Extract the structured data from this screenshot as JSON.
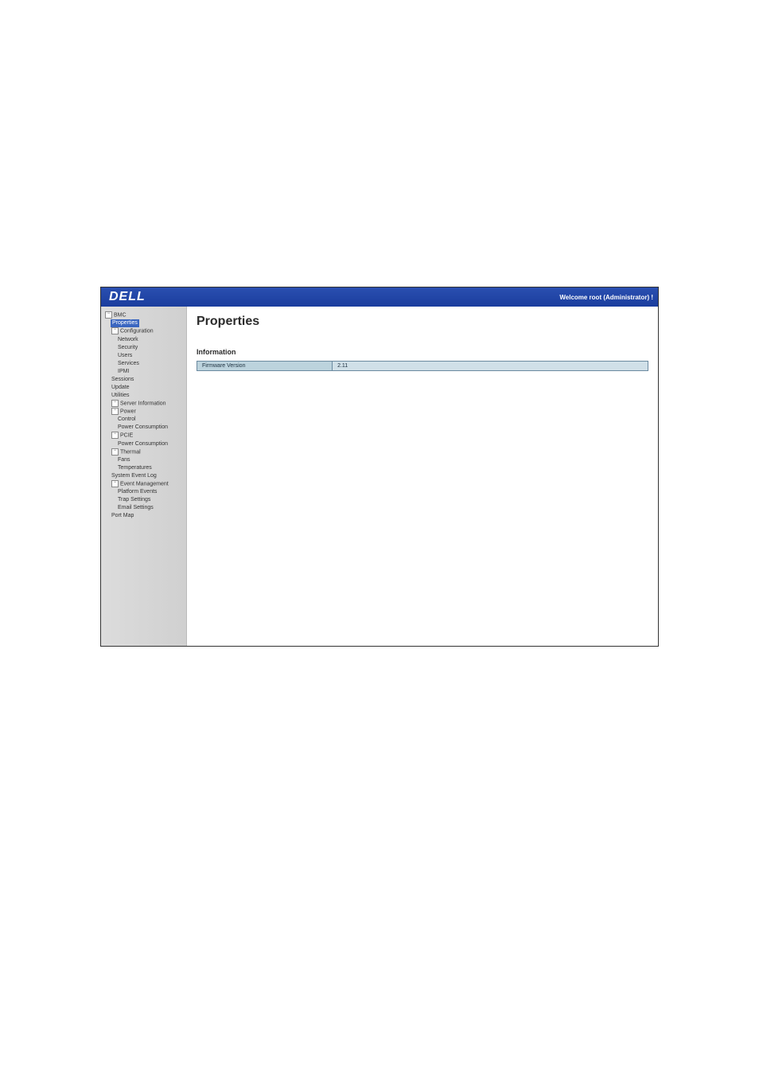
{
  "header": {
    "logo_text": "DELL",
    "welcome_text": "Welcome root (Administrator) !"
  },
  "sidebar": {
    "root": {
      "label": "BMC",
      "children": [
        {
          "label": "Properties",
          "selected": true
        },
        {
          "label": "Configuration",
          "expandable": true,
          "children": [
            {
              "label": "Network"
            },
            {
              "label": "Security"
            },
            {
              "label": "Users"
            },
            {
              "label": "Services"
            },
            {
              "label": "IPMI"
            }
          ]
        },
        {
          "label": "Sessions"
        },
        {
          "label": "Update"
        },
        {
          "label": "Utilities"
        },
        {
          "label": "Server Information",
          "expandable": true
        },
        {
          "label": "Power",
          "expandable": true,
          "children": [
            {
              "label": "Control"
            },
            {
              "label": "Power Consumption"
            }
          ]
        },
        {
          "label": "PCIE",
          "expandable": true,
          "children": [
            {
              "label": "Power Consumption"
            }
          ]
        },
        {
          "label": "Thermal",
          "expandable": true,
          "children": [
            {
              "label": "Fans"
            },
            {
              "label": "Temperatures"
            }
          ]
        },
        {
          "label": "System Event Log"
        },
        {
          "label": "Event Management",
          "expandable": true,
          "children": [
            {
              "label": "Platform Events"
            },
            {
              "label": "Trap Settings"
            },
            {
              "label": "Email Settings"
            }
          ]
        },
        {
          "label": "Port Map"
        }
      ]
    }
  },
  "content": {
    "title": "Properties",
    "section_title": "Information",
    "rows": [
      {
        "label": "Firmware Version",
        "value": "2.11"
      }
    ]
  }
}
